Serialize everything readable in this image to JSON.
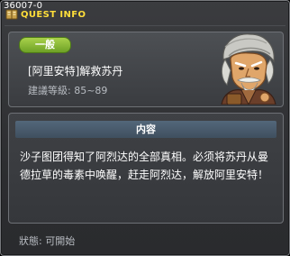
{
  "window": {
    "quest_id": "36007-0",
    "title": "QUEST INFO"
  },
  "header": {
    "level_badge": "一般",
    "quest_name": "[阿里安特]解救苏丹",
    "level_requirement": "建議等級: 85~89",
    "npc_portrait_icon": "elderly-npc-portrait"
  },
  "body": {
    "section_label": "内容",
    "description": "沙子图团得知了阿烈达的全部真相。必须将苏丹从曼德拉草的毒素中唤醒，赶走阿烈达，解放阿里安特！"
  },
  "footer": {
    "status": "狀態: 可開始"
  },
  "colors": {
    "title": "#ffde3a",
    "badge": "#8fbe39",
    "section_tab": "#4a5d70"
  }
}
